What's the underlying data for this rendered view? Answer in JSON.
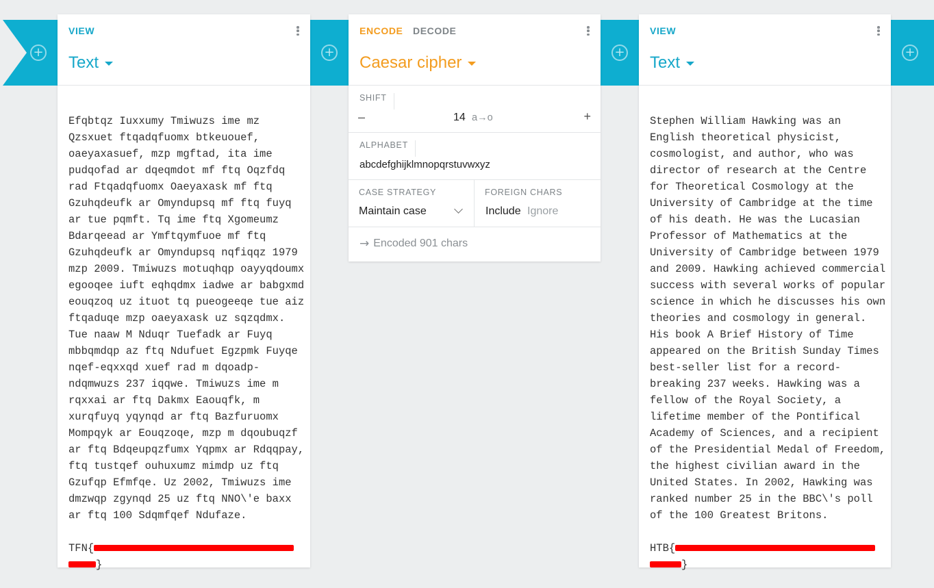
{
  "left_panel": {
    "tab": "VIEW",
    "title": "Text",
    "text": "Efqbtqz Iuxxumy Tmiwuzs ime mz Qzsxuet ftqadqfuomx btkeuouef, oaeyaxasuef, mzp mgftad, ita ime pudqofad ar dqeqmdot mf ftq Oqzfdq rad Ftqadqfuomx Oaeyaxask mf ftq Gzuhqdeufk ar Omyndupsq mf ftq fuyq ar tue pqmft. Tq ime ftq Xgomeumz Bdarqeead ar Ymftqymfuoe mf ftq Gzuhqdeufk ar Omyndupsq nqfiqqz 1979 mzp 2009. Tmiwuzs motuqhqp oayyqdoumx egooqee iuft eqhqdmx iadwe ar babgxmd eouqzoq uz ituot tq pueogeeqe tue aiz ftqaduqe mzp oaeyaxask uz sqzqdmx. Tue naaw M Nduqr Tuefadk ar Fuyq mbbqmdqp az ftq Ndufuet Egzpmk Fuyqe nqef-eqxxqd xuef rad m dqoadp-ndqmwuzs 237 iqqwe. Tmiwuzs ime m rqxxai ar ftq Dakmx Eaouqfk, m xurqfuyq yqynqd ar ftq Bazfuruomx Mompqyk ar Eouqzoqe, mzp m dqoubuqzf ar ftq Bdqeupqzfumx Yqpmx ar Rdqqpay, ftq tustqef ouhuxumz mimdp uz ftq Gzufqp Efmfqe. Uz 2002, Tmiwuzs ime dmzwqp zgynqd 25 uz ftq NNO\\'e baxx ar ftq 100 Sdqmfqef Ndufaze.",
    "flag_prefix": "TFN{",
    "flag_suffix": "}"
  },
  "mid_panel": {
    "tab_encode": "ENCODE",
    "tab_decode": "DECODE",
    "title": "Caesar cipher",
    "shift_label": "SHIFT",
    "shift_minus": "–",
    "shift_value": "14",
    "shift_map": "a→o",
    "shift_plus": "+",
    "alphabet_label": "ALPHABET",
    "alphabet_value": "abcdefghijklmnopqrstuvwxyz",
    "case_label": "CASE STRATEGY",
    "case_value": "Maintain case",
    "foreign_label": "FOREIGN CHARS",
    "foreign_include": "Include",
    "foreign_ignore": "Ignore",
    "status": "Encoded 901 chars"
  },
  "right_panel": {
    "tab": "VIEW",
    "title": "Text",
    "text": "Stephen William Hawking was an English theoretical physicist, cosmologist, and author, who was director of research at the Centre for Theoretical Cosmology at the University of Cambridge at the time of his death. He was the Lucasian Professor of Mathematics at the University of Cambridge between 1979 and 2009. Hawking achieved commercial success with several works of popular science in which he discusses his own theories and cosmology in general. His book A Brief History of Time appeared on the British Sunday Times best-seller list for a record-breaking 237 weeks. Hawking was a fellow of the Royal Society, a lifetime member of the Pontifical Academy of Sciences, and a recipient of the Presidential Medal of Freedom, the highest civilian award in the United States. In 2002, Hawking was ranked number 25 in the BBC\\'s poll of the 100 Greatest Britons.",
    "flag_prefix": "HTB{",
    "flag_suffix": "}"
  },
  "colors": {
    "accent_blue": "#16a7c9",
    "strip_blue": "#0eaed0",
    "accent_orange": "#f39c1f",
    "redaction": "#ff0000"
  },
  "icons": [
    "add-circle-icon",
    "more-vert-icon",
    "dropdown-caret-icon",
    "chevron-down-icon",
    "arrow-right-icon"
  ]
}
